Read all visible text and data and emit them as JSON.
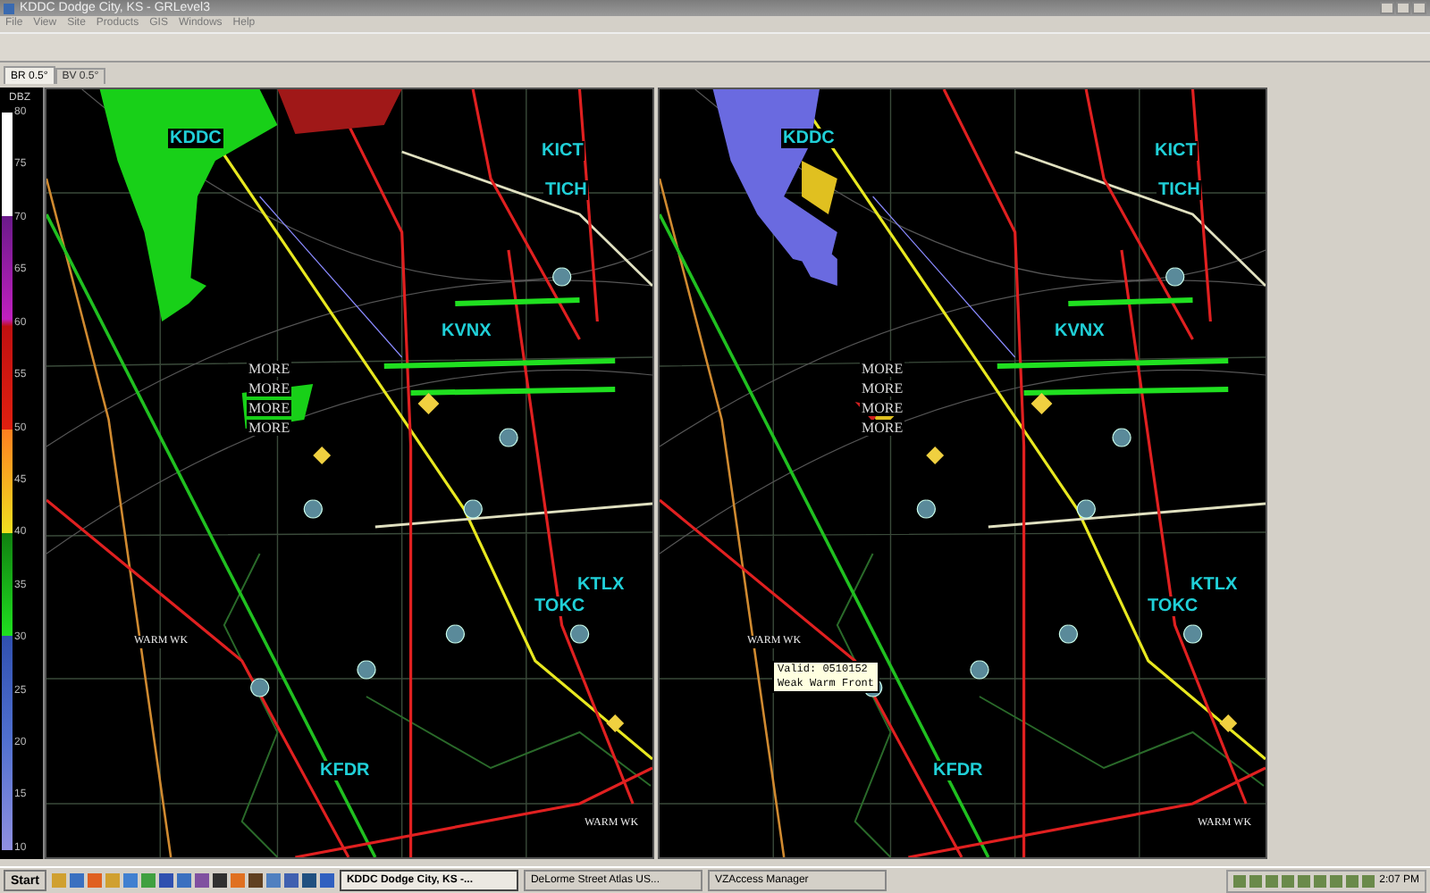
{
  "window": {
    "title": "KDDC Dodge City, KS - GRLevel3"
  },
  "menu": [
    "File",
    "View",
    "Site",
    "Products",
    "GIS",
    "Windows",
    "Help"
  ],
  "tabs": [
    {
      "label": "BR 0.5°",
      "selected": true
    },
    {
      "label": "BV 0.5°",
      "selected": false
    }
  ],
  "legend": {
    "unit": "DBZ",
    "ticks": [
      "80",
      "75",
      "70",
      "65",
      "60",
      "55",
      "50",
      "45",
      "40",
      "35",
      "30",
      "25",
      "20",
      "15",
      "10"
    ]
  },
  "panels": [
    {
      "kind": "reflectivity",
      "stations": [
        "KDDC",
        "KICT",
        "TICH",
        "KVNX",
        "KTLX",
        "TOKC",
        "KFDR"
      ],
      "notes": [
        "MORE",
        "MORE",
        "MORE",
        "MORE"
      ],
      "fronts": [
        "WARM WK",
        "WARM WK"
      ]
    },
    {
      "kind": "velocity",
      "stations": [
        "KDDC",
        "KICT",
        "TICH",
        "KVNX",
        "KTLX",
        "TOKC",
        "KFDR"
      ],
      "notes": [
        "MORE",
        "MORE",
        "MORE",
        "MORE"
      ],
      "fronts": [
        "WARM WK",
        "WARM WK"
      ],
      "tooltip": [
        "Valid: 0510152",
        "Weak Warm Front"
      ]
    }
  ],
  "taskbar": {
    "start": "Start",
    "tasks": [
      {
        "label": "KDDC Dodge City, KS -...",
        "selected": true
      },
      {
        "label": "DeLorme Street Atlas US...",
        "selected": false
      },
      {
        "label": "VZAccess Manager",
        "selected": false
      }
    ],
    "clock": "2:07 PM"
  }
}
